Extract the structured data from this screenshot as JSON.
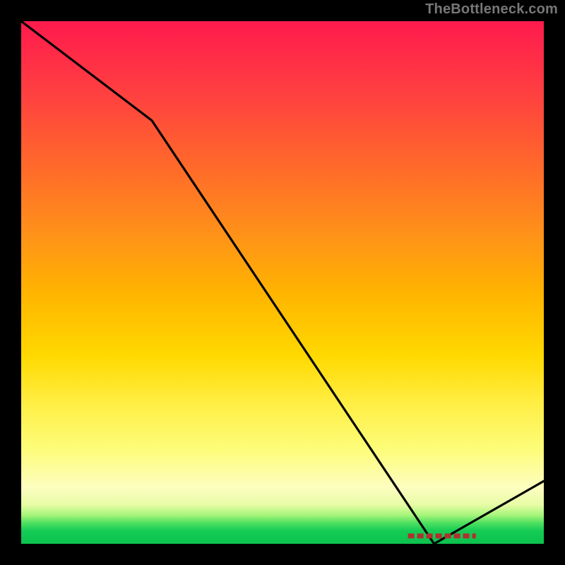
{
  "watermark": "TheBottleneck.com",
  "chart_data": {
    "type": "line",
    "x": [
      0.0,
      0.25,
      0.79,
      1.0
    ],
    "values": [
      1.0,
      0.81,
      0.0,
      0.12
    ],
    "xlim": [
      0,
      1
    ],
    "ylim": [
      0,
      1
    ],
    "xlabel": "",
    "ylabel": "",
    "title": "",
    "annotations": [
      {
        "name": "recommended-range",
        "x_start": 0.74,
        "x_end": 0.87,
        "y": 0.015
      }
    ],
    "colors": {
      "line": "#000000",
      "recommended_dash": "#b03030",
      "gradient_top": "#ff1a4d",
      "gradient_bottom": "#0bc24e"
    }
  }
}
